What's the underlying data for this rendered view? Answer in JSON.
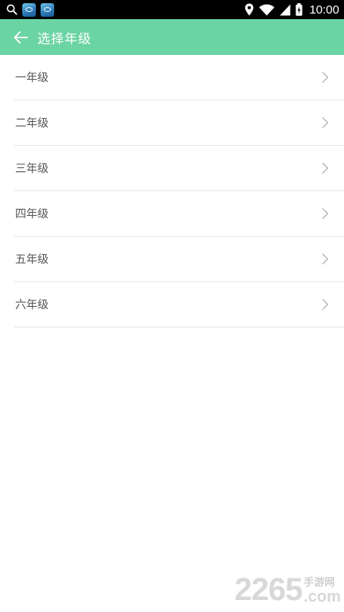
{
  "status_bar": {
    "time": "10:00",
    "icons": [
      "search-icon",
      "app-icon",
      "app-icon",
      "location-icon",
      "wifi-icon",
      "signal-icon",
      "battery-icon"
    ]
  },
  "header": {
    "title": "选择年级",
    "back_icon": "arrow-left-icon",
    "background_color": "#6bd4a4"
  },
  "grades": [
    {
      "label": "一年级"
    },
    {
      "label": "二年级"
    },
    {
      "label": "三年级"
    },
    {
      "label": "四年级"
    },
    {
      "label": "五年级"
    },
    {
      "label": "六年级"
    }
  ],
  "watermark": {
    "number": "2265",
    "site": "手游网",
    "domain": ".com"
  }
}
